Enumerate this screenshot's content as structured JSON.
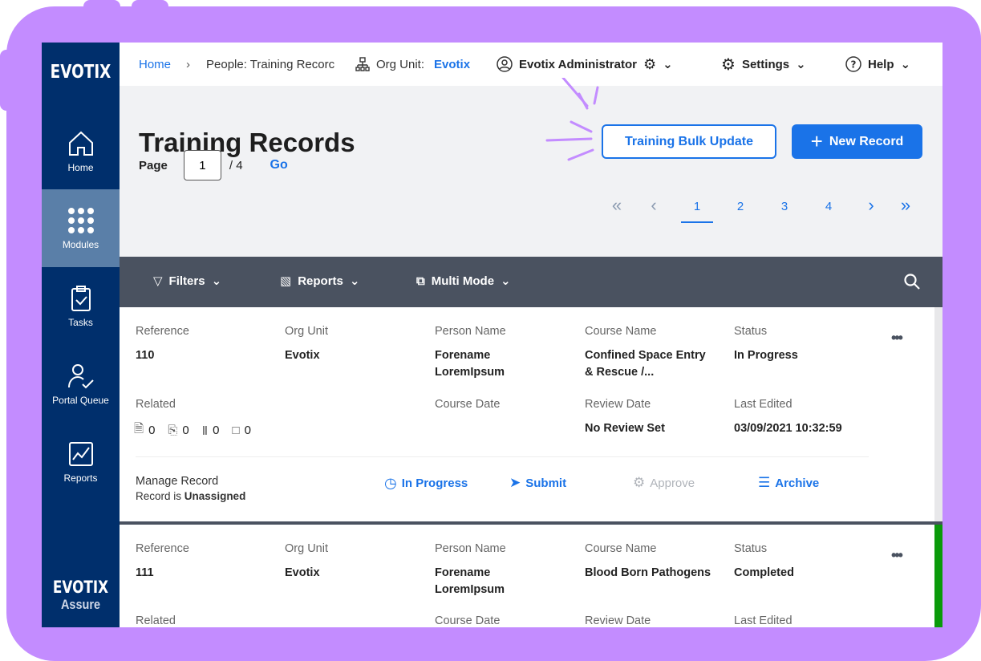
{
  "sidebar": {
    "logo": "EVOTIX",
    "items": [
      {
        "label": "Home",
        "icon": "home-icon"
      },
      {
        "label": "Modules",
        "icon": "grid-icon",
        "active": true
      },
      {
        "label": "Tasks",
        "icon": "clipboard-check-icon"
      },
      {
        "label": "Portal Queue",
        "icon": "user-check-icon"
      },
      {
        "label": "Reports",
        "icon": "chart-icon"
      }
    ],
    "bottom_logo": "EVOTIX",
    "bottom_sub": "Assure"
  },
  "header": {
    "home": "Home",
    "crumb": "People: Training Recorc",
    "org_label": "Org Unit:",
    "org_value": "Evotix",
    "user": "Evotix Administrator",
    "settings": "Settings",
    "help": "Help"
  },
  "page": {
    "title": "Training Records",
    "bulk_update": "Training Bulk Update",
    "new_record": "New Record"
  },
  "pager": {
    "label": "Page",
    "current": "1",
    "total": "/ 4",
    "go": "Go",
    "pages": [
      "1",
      "2",
      "3",
      "4"
    ]
  },
  "toolbar": {
    "filters": "Filters",
    "reports": "Reports",
    "multi_mode": "Multi Mode"
  },
  "labels": {
    "reference": "Reference",
    "org_unit": "Org Unit",
    "person_name": "Person Name",
    "course_name": "Course Name",
    "status": "Status",
    "related": "Related",
    "course_date": "Course Date",
    "review_date": "Review Date",
    "last_edited": "Last Edited",
    "manage": "Manage Record",
    "record_is": "Record is",
    "unassigned": "Unassigned"
  },
  "records": [
    {
      "reference": "110",
      "org_unit": "Evotix",
      "person_1": "Forename",
      "person_2": "LoremIpsum",
      "course_1": "Confined Space Entry",
      "course_2": "& Rescue /...",
      "status": "In Progress",
      "related": [
        "0",
        "0",
        "0",
        "0"
      ],
      "review_date": "No Review Set",
      "last_edited": "03/09/2021 10:32:59",
      "actions": [
        "In Progress",
        "Submit",
        "Approve",
        "Archive"
      ]
    },
    {
      "reference": "111",
      "org_unit": "Evotix",
      "person_1": "Forename",
      "person_2": "LoremIpsum",
      "course_1": "Blood Born Pathogens",
      "status": "Completed",
      "status_color": "#0a9a0a"
    }
  ],
  "colors": {
    "frame": "#c38cff",
    "sidebar": "#002f6c",
    "accent": "#1a73e8",
    "toolbar": "#4a5260"
  }
}
